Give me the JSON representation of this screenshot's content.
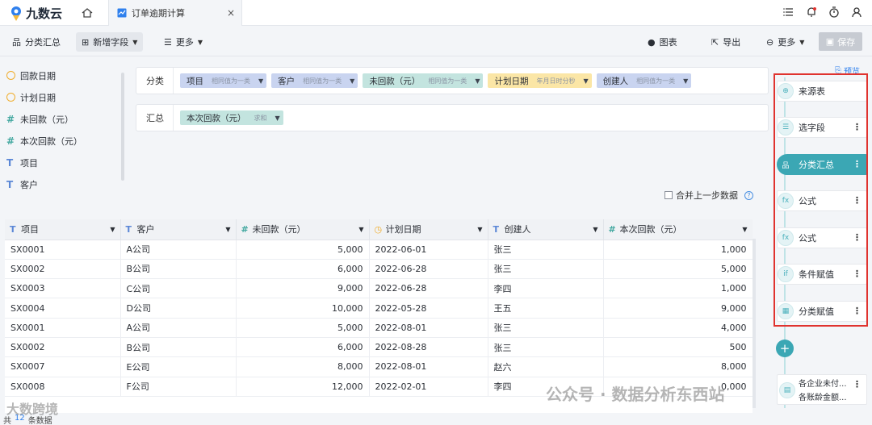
{
  "app": {
    "logo_text": "九数云",
    "tab_title": "订单逾期计算",
    "tab_close": "×"
  },
  "colors": {
    "accent": "#3ba7b4",
    "highlight": "#e0332f",
    "link": "#2f80ed",
    "chip_blue": "#c9d4f0",
    "chip_teal": "#c3e4df",
    "chip_yellow": "#fbe6a6"
  },
  "toolbar": {
    "group_summary": "分类汇总",
    "add_field": "新增字段",
    "more": "更多",
    "chart": "图表",
    "export": "导出",
    "more_right": "更多",
    "save": "保存"
  },
  "fields": [
    {
      "type": "date",
      "label": "回款日期"
    },
    {
      "type": "date",
      "label": "计划日期"
    },
    {
      "type": "number",
      "label": "未回款（元）"
    },
    {
      "type": "number",
      "label": "本次回款（元）"
    },
    {
      "type": "text",
      "label": "项目"
    },
    {
      "type": "text",
      "label": "客户"
    }
  ],
  "group": {
    "label": "分类",
    "chips": [
      {
        "name": "项目",
        "sub": "相同值为一类"
      },
      {
        "name": "客户",
        "sub": "相同值为一类"
      },
      {
        "name": "未回款（元）",
        "sub": "相同值为一类"
      },
      {
        "name": "计划日期",
        "sub": "年月日时分秒"
      },
      {
        "name": "创建人",
        "sub": "相同值为一类"
      }
    ]
  },
  "summary": {
    "label": "汇总",
    "chips": [
      {
        "name": "本次回款（元）",
        "sub": "求和"
      }
    ]
  },
  "merge_label": "合并上一步数据",
  "table": {
    "headers": [
      "项目",
      "客户",
      "未回款（元）",
      "计划日期",
      "创建人",
      "本次回款（元）"
    ],
    "header_icons": [
      "T",
      "T",
      "#",
      "◷",
      "T",
      "#"
    ],
    "rows": [
      [
        "SX0001",
        "A公司",
        "5,000",
        "2022-06-01",
        "张三",
        "1,000"
      ],
      [
        "SX0002",
        "B公司",
        "6,000",
        "2022-06-28",
        "张三",
        "5,000"
      ],
      [
        "SX0003",
        "C公司",
        "9,000",
        "2022-06-28",
        "李四",
        "1,000"
      ],
      [
        "SX0004",
        "D公司",
        "10,000",
        "2022-05-28",
        "王五",
        "9,000"
      ],
      [
        "SX0001",
        "A公司",
        "5,000",
        "2022-08-01",
        "张三",
        "4,000"
      ],
      [
        "SX0002",
        "B公司",
        "6,000",
        "2022-08-28",
        "张三",
        "500"
      ],
      [
        "SX0007",
        "E公司",
        "8,000",
        "2022-08-01",
        "赵六",
        "8,000"
      ],
      [
        "SX0008",
        "F公司",
        "12,000",
        "2022-02-01",
        "李四",
        "0,000"
      ]
    ]
  },
  "footer": {
    "prefix": "共",
    "count": "12",
    "suffix": "条数据"
  },
  "pipeline": {
    "preview": "预览",
    "steps": [
      {
        "label": "来源表",
        "icon": "⊕"
      },
      {
        "label": "选字段",
        "icon": "☰"
      },
      {
        "label": "分类汇总",
        "icon": "品"
      },
      {
        "label": "公式",
        "icon": "fx"
      },
      {
        "label": "公式",
        "icon": "fx"
      },
      {
        "label": "条件赋值",
        "icon": "if"
      },
      {
        "label": "分类赋值",
        "icon": "▦"
      }
    ],
    "extra": [
      "各企业未付...",
      "各账龄金额..."
    ]
  },
  "watermarks": {
    "left": "大数跨境",
    "right": "公众号 · 数据分析东西站"
  }
}
